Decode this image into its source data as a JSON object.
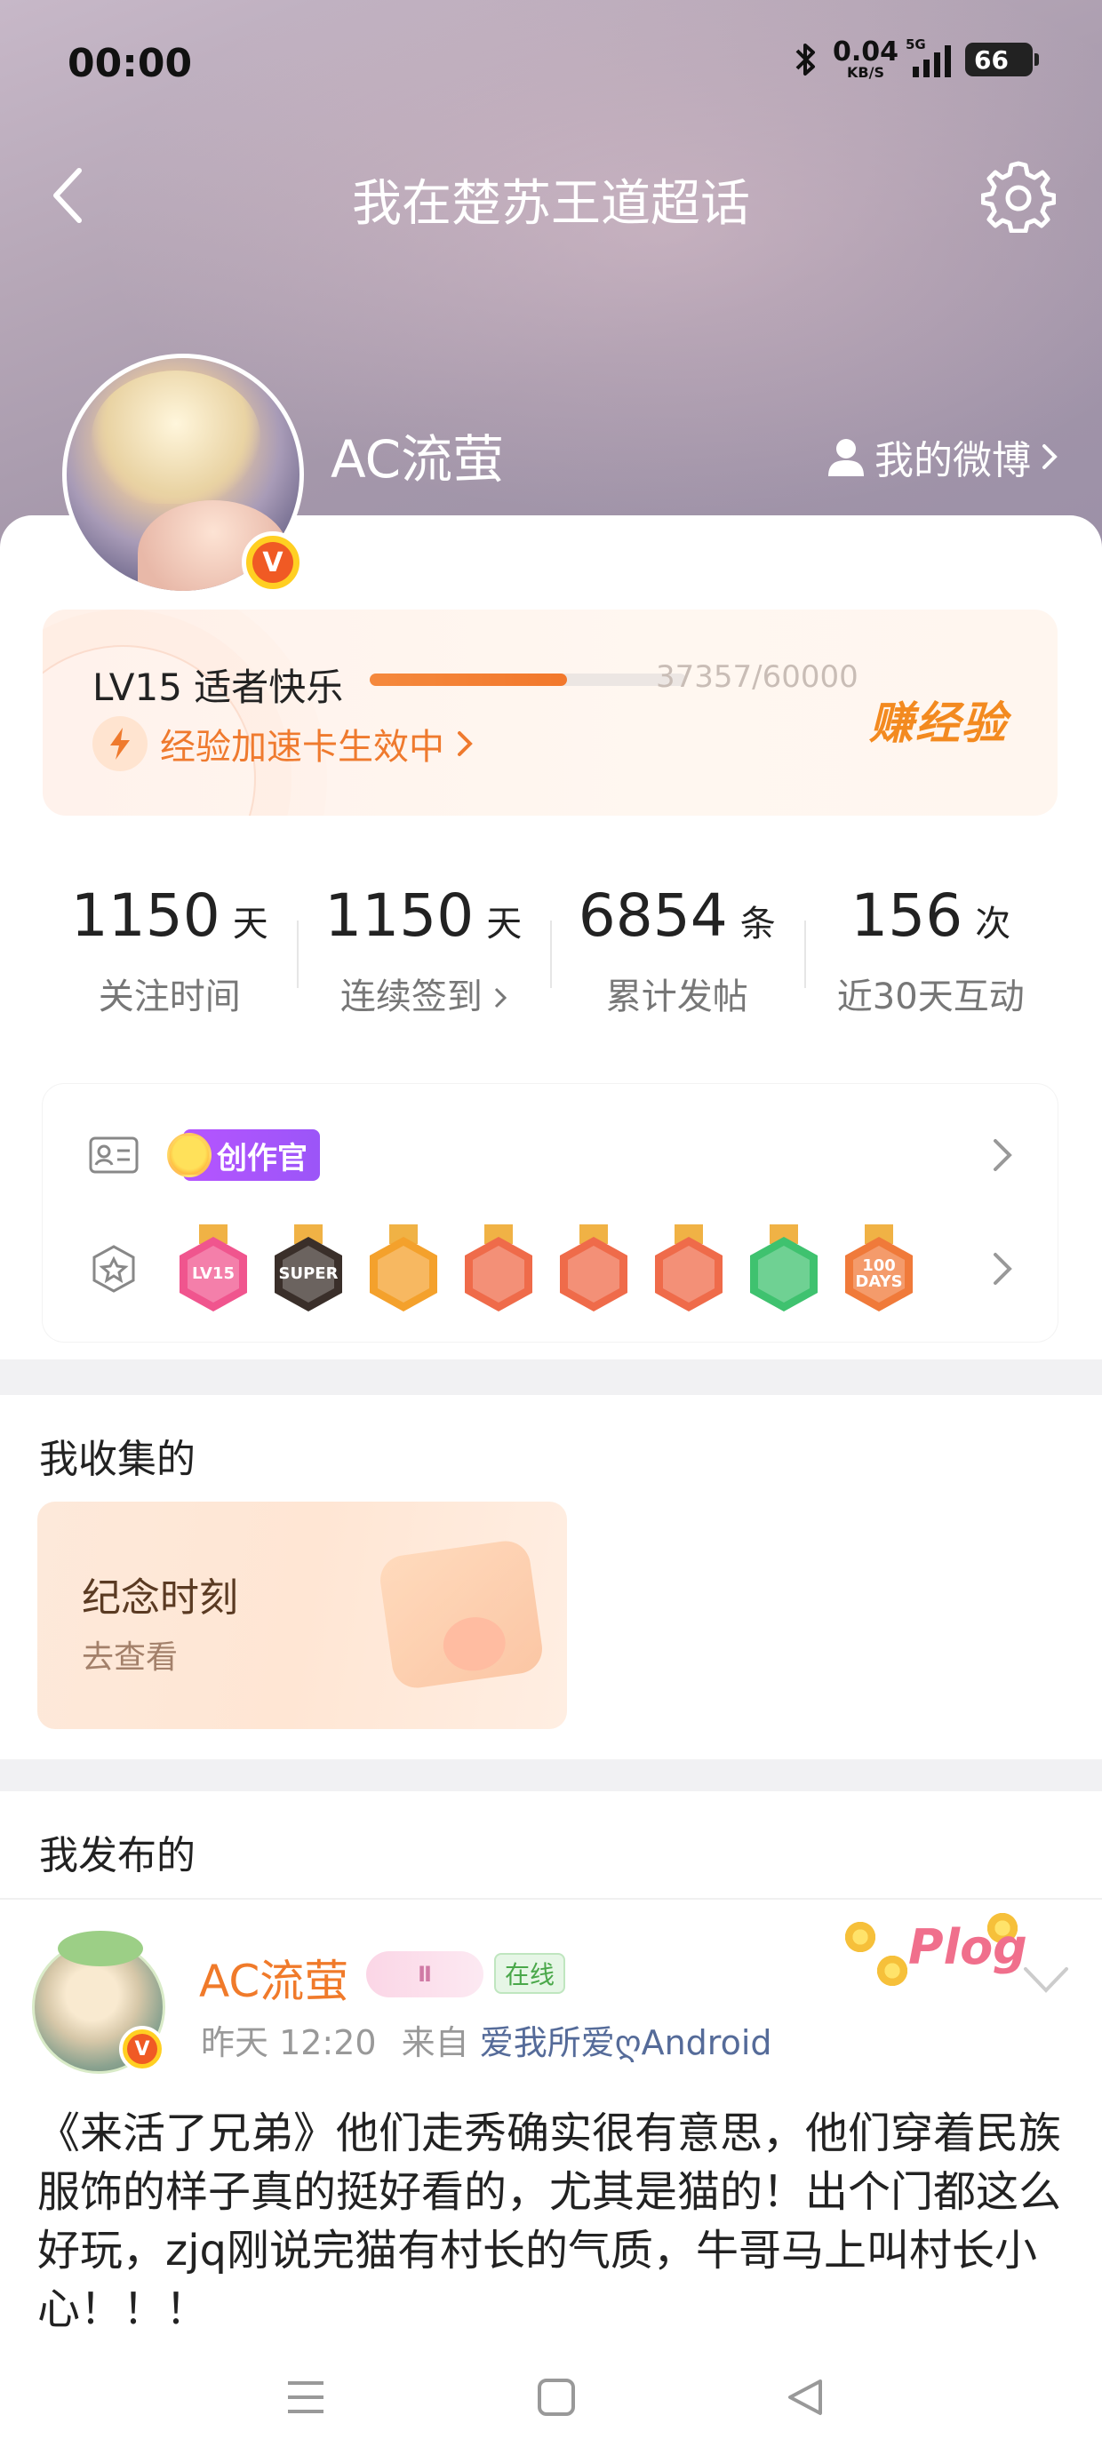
{
  "status_bar": {
    "time": "00:00",
    "net_speed": "0.04",
    "net_unit": "KB/S",
    "network": "5G",
    "battery": "66"
  },
  "nav": {
    "title": "我在楚苏王道超话",
    "back_icon": "chevron-left-icon",
    "settings_icon": "gear-icon"
  },
  "profile": {
    "username": "AC流萤",
    "verified_badge": "V",
    "my_weibo_label": "我的微博"
  },
  "level": {
    "name": "LV15 适者快乐",
    "progress_text": "37357/60000",
    "progress_fraction": 0.6226,
    "boost_label": "经验加速卡生效中",
    "earn_label": "赚经验"
  },
  "stats": [
    {
      "value": "1150",
      "unit": "天",
      "label": "关注时间"
    },
    {
      "value": "1150",
      "unit": "天",
      "label": "连续签到"
    },
    {
      "value": "6854",
      "unit": "条",
      "label": "累计发帖"
    },
    {
      "value": "156",
      "unit": "次",
      "label": "近30天互动"
    }
  ],
  "badges": {
    "creator_tag": "创作官",
    "medals": [
      {
        "text": "LV15",
        "color": "#f0558e"
      },
      {
        "text": "SUPER",
        "color": "#3a2f2a"
      },
      {
        "text": "",
        "color": "#f4a12c"
      },
      {
        "text": "",
        "color": "#ef6b4a"
      },
      {
        "text": "",
        "color": "#ef6b4a"
      },
      {
        "text": "",
        "color": "#ef6b4a"
      },
      {
        "text": "",
        "color": "#3fc26f"
      },
      {
        "text": "100 DAYS",
        "color": "#f07a3a"
      }
    ]
  },
  "collection": {
    "title": "我收集的",
    "card_title": "纪念时刻",
    "card_sub": "去查看"
  },
  "posts": {
    "title": "我发布的",
    "author": "AC流萤",
    "vip_tag": "Ⅱ",
    "online_tag": "在线",
    "time": "昨天 12:20",
    "from_label": "来自",
    "source": "爱我所爱ღAndroid",
    "sticker": "Plog",
    "body": "《来活了兄弟》他们走秀确实很有意思，他们穿着民族服饰的样子真的挺好看的，尤其是猫的！出个门都这么好玩，zjq刚说完猫有村长的气质，牛哥马上叫村长小心！！！"
  },
  "colors": {
    "accent": "#f07a2a",
    "creator_purple": "#a855f7",
    "link": "#556b99"
  }
}
